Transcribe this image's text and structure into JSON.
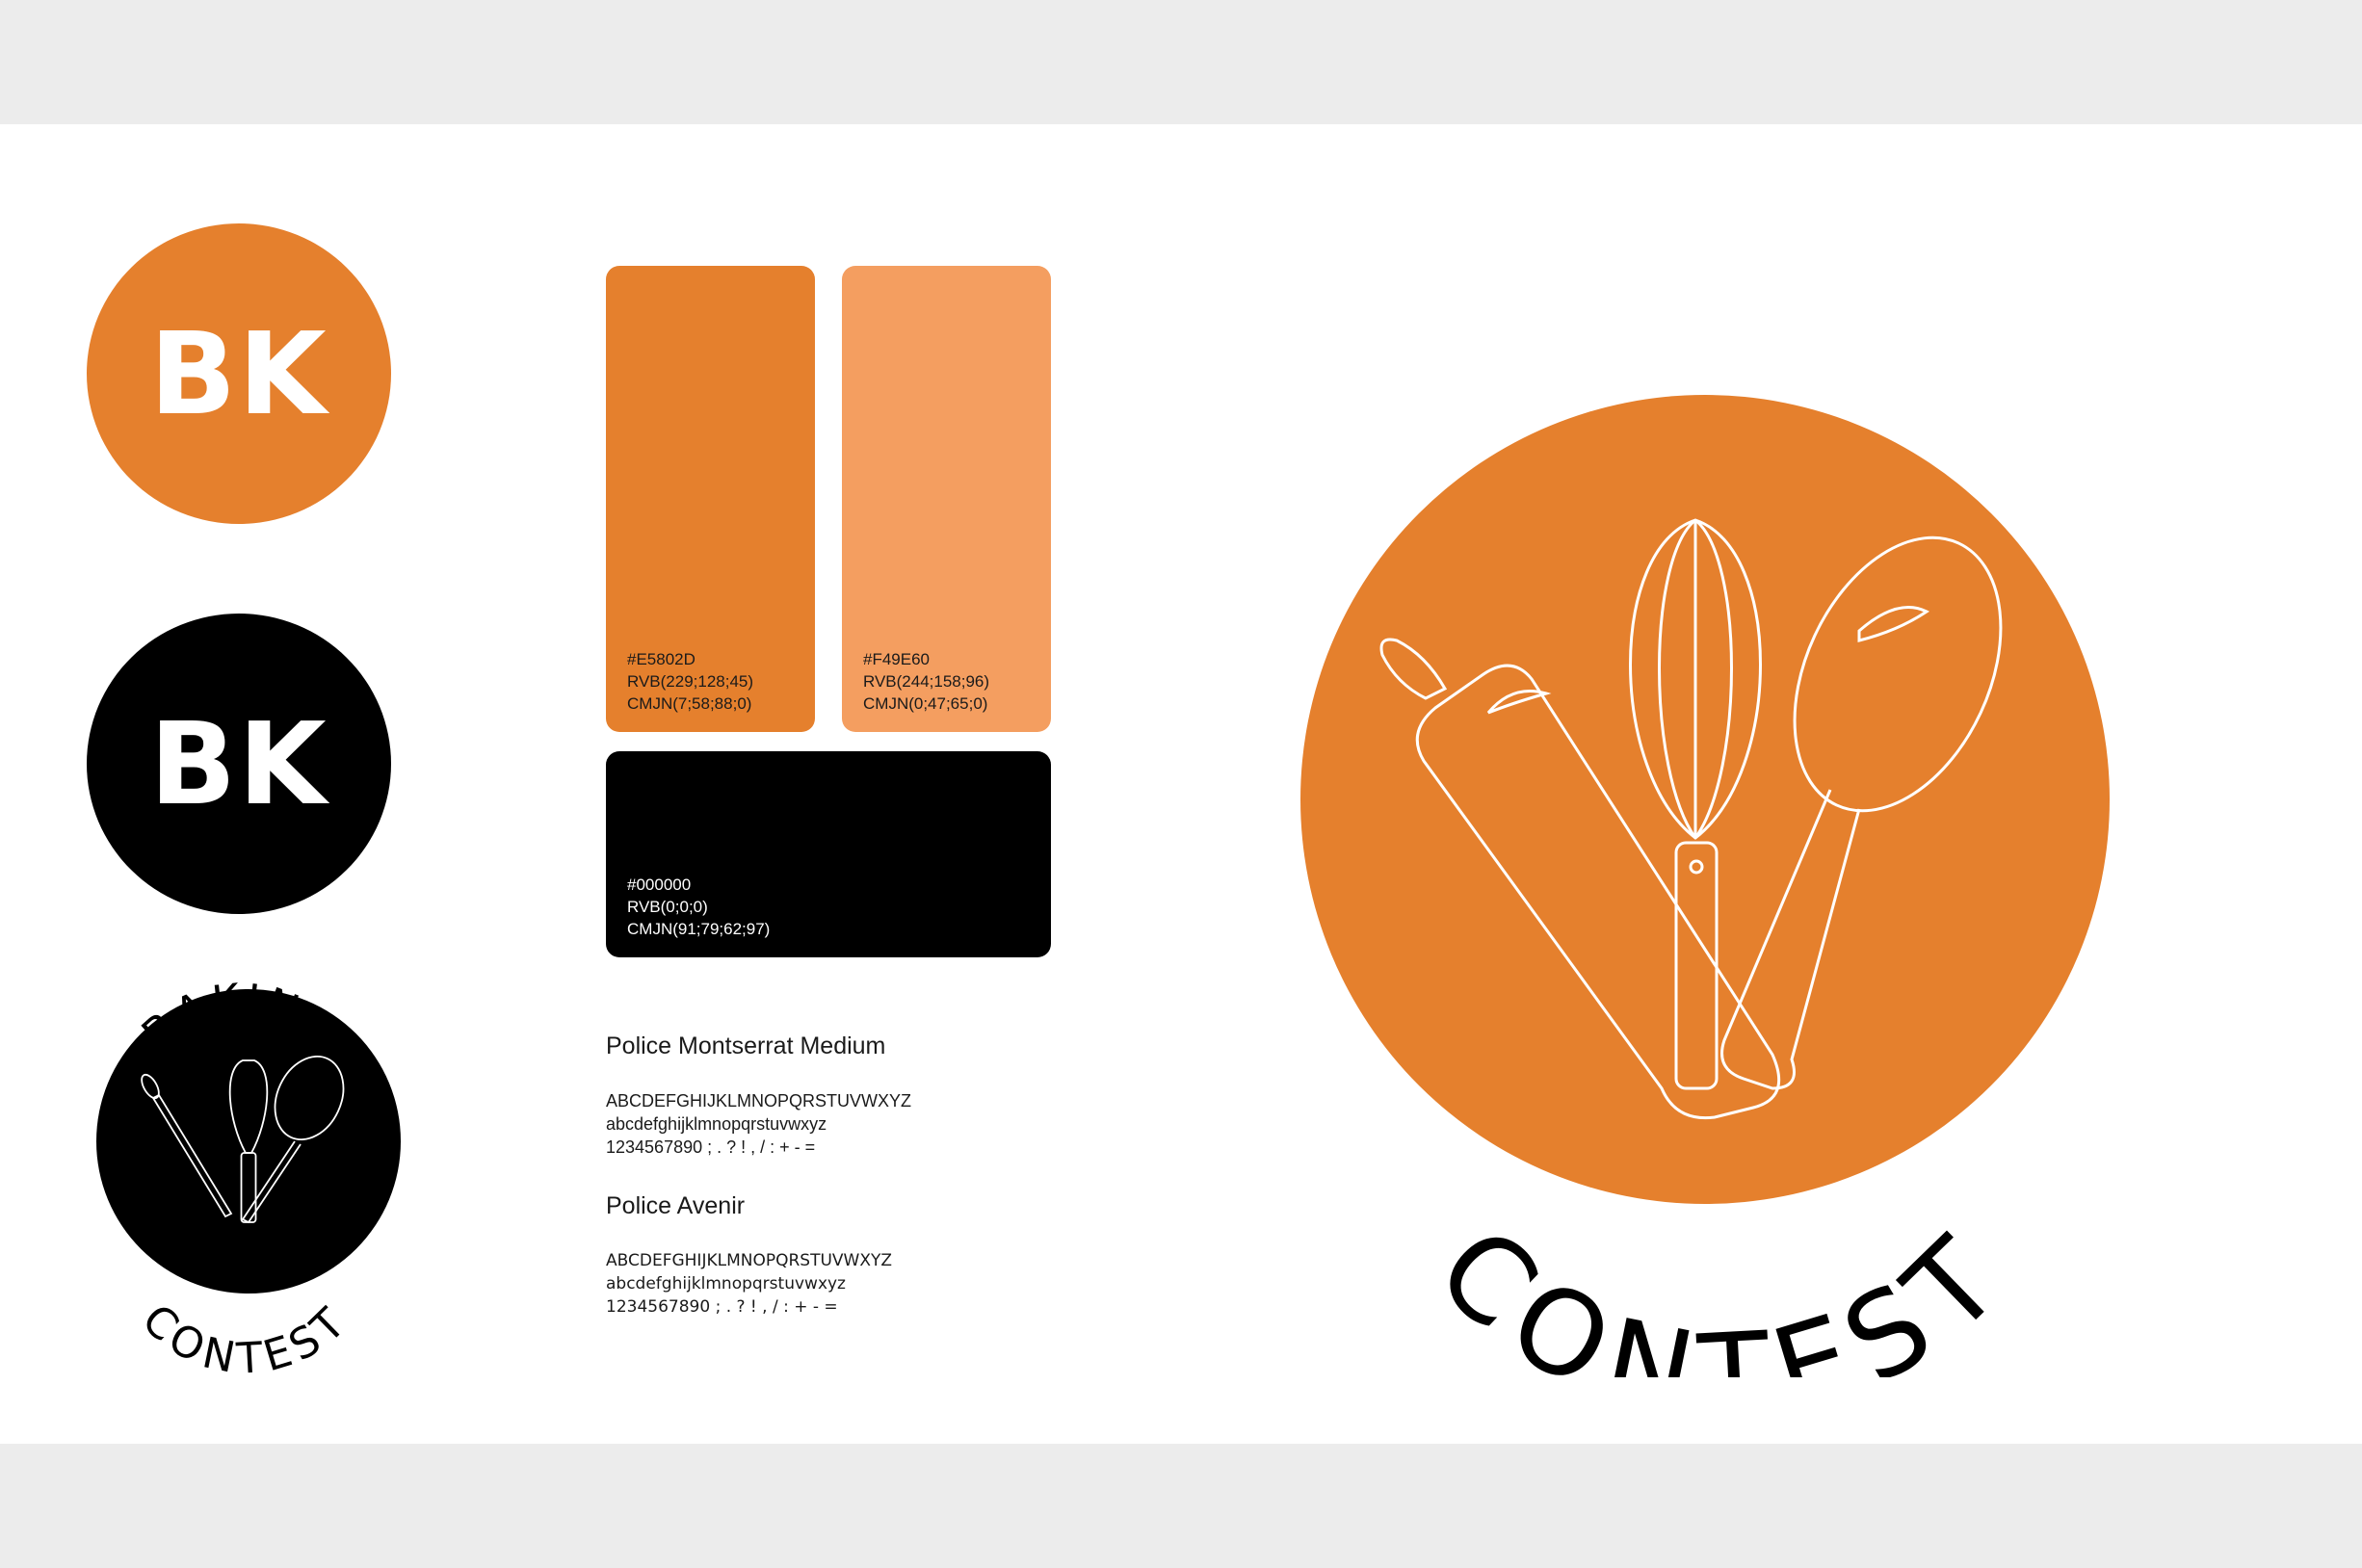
{
  "brand": {
    "monogram": "BK",
    "logo_word_top": "BAKING",
    "logo_word_bottom": "CONTEST"
  },
  "palette": [
    {
      "hex": "#E5802D",
      "rvb": "RVB(229;128;45)",
      "cmjn": "CMJN(7;58;88;0)",
      "color": "#E5802D",
      "text_color": "#1a1a1a"
    },
    {
      "hex": "#F49E60",
      "rvb": "RVB(244;158;96)",
      "cmjn": "CMJN(0;47;65;0)",
      "color": "#F49E60",
      "text_color": "#1a1a1a"
    },
    {
      "hex": "#000000",
      "rvb": "RVB(0;0;0)",
      "cmjn": "CMJN(91;79;62;97)",
      "color": "#000000",
      "text_color": "#ffffff"
    }
  ],
  "fonts": [
    {
      "title": "Police Montserrat Medium",
      "uppercase": "ABCDEFGHIJKLMNOPQRSTUVWXYZ",
      "lowercase": "abcdefghijklmnopqrstuvwxyz",
      "digits": "1234567890 ; . ? ! , / : + - ="
    },
    {
      "title": "Police Avenir",
      "uppercase": "ABCDEFGHIJKLMNOPQRSTUVWXYZ",
      "lowercase": "abcdefghijklmnopqrstuvwxyz",
      "digits": "1234567890 ; . ? ! , / : + - ="
    }
  ],
  "colors": {
    "orange": "#E5802D",
    "light_orange": "#F49E60",
    "black": "#000000",
    "background": "#ececec",
    "sheet": "#ffffff"
  }
}
